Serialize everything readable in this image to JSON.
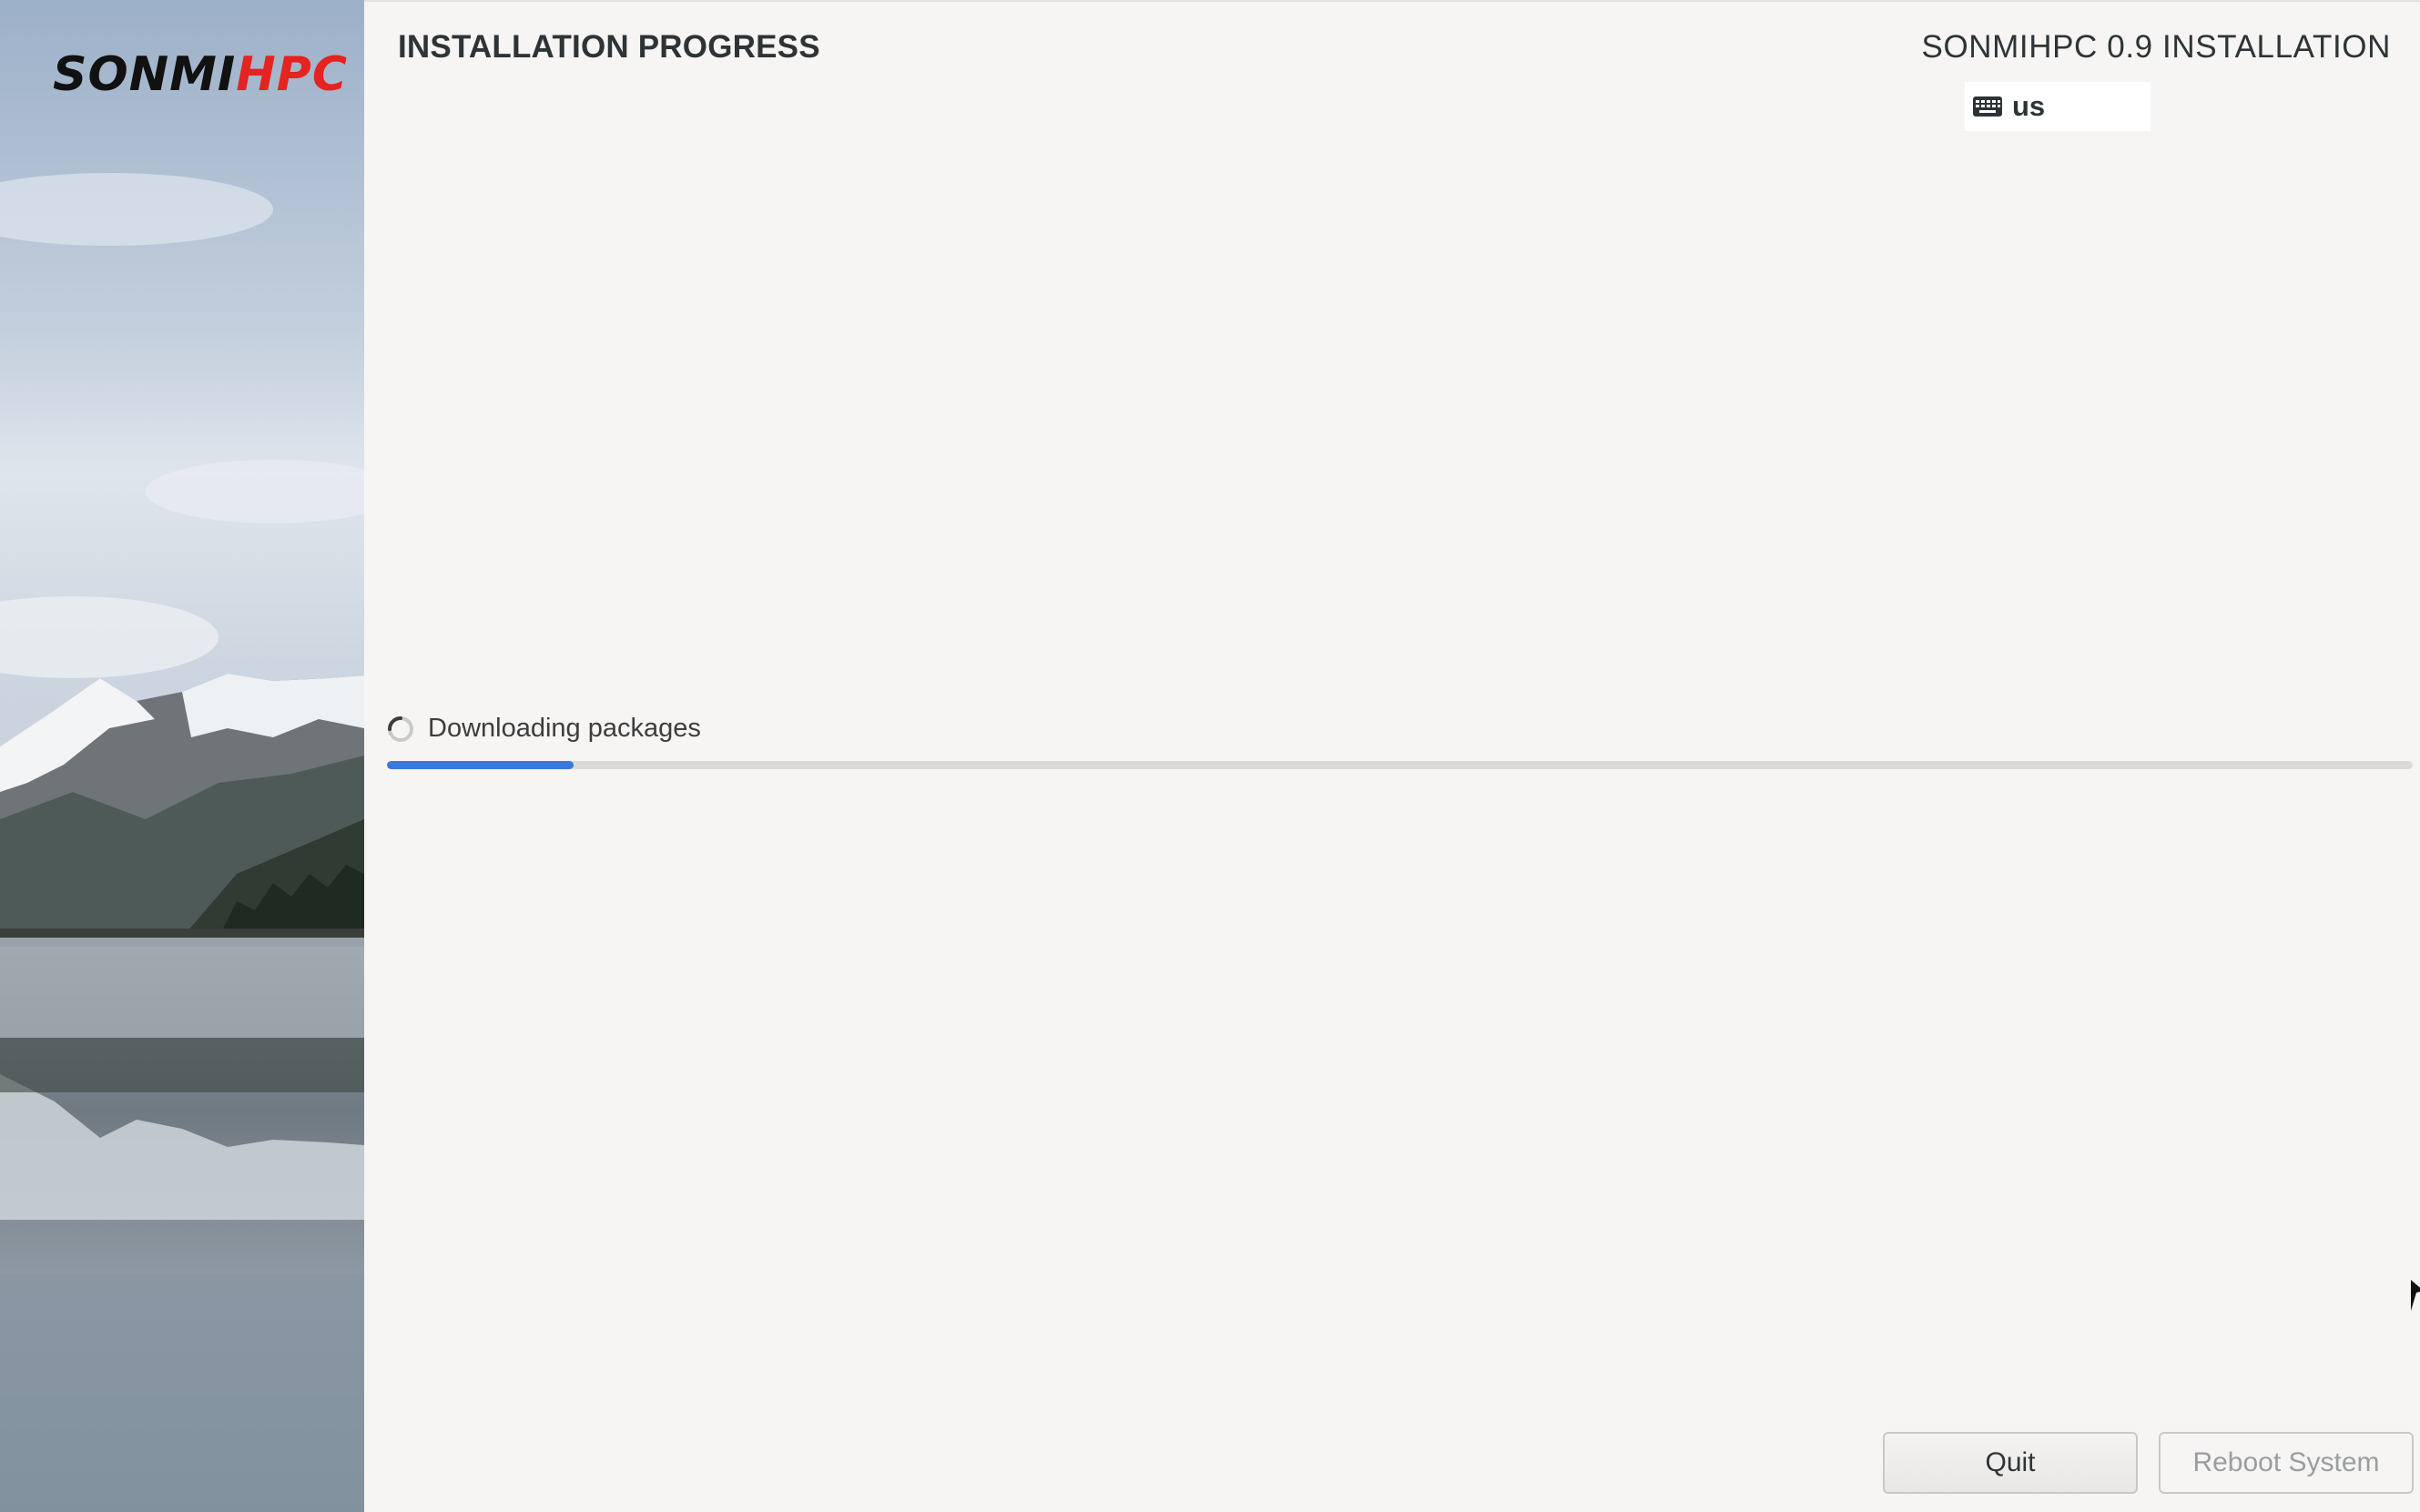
{
  "sidebar": {
    "logo": {
      "part1": "SONMI",
      "part2": "HPC"
    }
  },
  "header": {
    "page_title": "INSTALLATION PROGRESS",
    "product_title": "SONMIHPC 0.9 INSTALLATION",
    "keyboard_layout": "us",
    "keyboard_icon": "keyboard-icon"
  },
  "progress": {
    "status_text": "Downloading packages",
    "status_icon": "spinner-icon",
    "fraction": 0.092,
    "bar_color": "#3c78d8"
  },
  "buttons": {
    "quit_label": "Quit",
    "reboot_label": "Reboot System"
  },
  "colors": {
    "logo_accent": "#e32420",
    "background": "#f6f5f4"
  }
}
